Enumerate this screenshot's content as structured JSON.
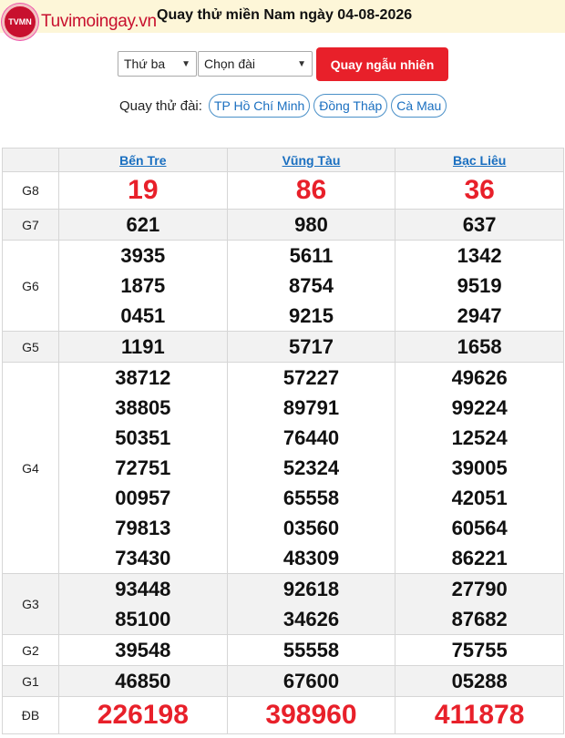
{
  "header": {
    "logo_badge": "TVMN",
    "logo_text": "Tuvimoingay.vn",
    "title": "Quay thử miền Nam ngày 04-08-2026",
    "logo_color": "#c8102e"
  },
  "controls": {
    "day_select": "Thứ ba",
    "station_select": "Chọn đài",
    "spin_button": "Quay ngẫu nhiên",
    "quick_label": "Quay thử đài:",
    "quick_stations": [
      "TP Hồ Chí Minh",
      "Đồng Tháp",
      "Cà Mau"
    ]
  },
  "table": {
    "stations": [
      "Bến Tre",
      "Vũng Tàu",
      "Bạc Liêu"
    ],
    "prizes": [
      {
        "name": "G8",
        "style": "big",
        "values": [
          [
            "19"
          ],
          [
            "86"
          ],
          [
            "36"
          ]
        ]
      },
      {
        "name": "G7",
        "values": [
          [
            "621"
          ],
          [
            "980"
          ],
          [
            "637"
          ]
        ]
      },
      {
        "name": "G6",
        "values": [
          [
            "3935",
            "1875",
            "0451"
          ],
          [
            "5611",
            "8754",
            "9215"
          ],
          [
            "1342",
            "9519",
            "2947"
          ]
        ]
      },
      {
        "name": "G5",
        "values": [
          [
            "1191"
          ],
          [
            "5717"
          ],
          [
            "1658"
          ]
        ]
      },
      {
        "name": "G4",
        "values": [
          [
            "38712",
            "38805",
            "50351",
            "72751",
            "00957",
            "79813",
            "73430"
          ],
          [
            "57227",
            "89791",
            "76440",
            "52324",
            "65558",
            "03560",
            "48309"
          ],
          [
            "49626",
            "99224",
            "12524",
            "39005",
            "42051",
            "60564",
            "86221"
          ]
        ]
      },
      {
        "name": "G3",
        "values": [
          [
            "93448",
            "85100"
          ],
          [
            "92618",
            "34626"
          ],
          [
            "27790",
            "87682"
          ]
        ]
      },
      {
        "name": "G2",
        "values": [
          [
            "39548"
          ],
          [
            "55558"
          ],
          [
            "75755"
          ]
        ]
      },
      {
        "name": "G1",
        "values": [
          [
            "46850"
          ],
          [
            "67600"
          ],
          [
            "05288"
          ]
        ]
      },
      {
        "name": "ĐB",
        "style": "db",
        "values": [
          [
            "226198"
          ],
          [
            "398960"
          ],
          [
            "411878"
          ]
        ]
      }
    ],
    "accent_color": "#e8202a",
    "link_color": "#1a6fc0"
  }
}
